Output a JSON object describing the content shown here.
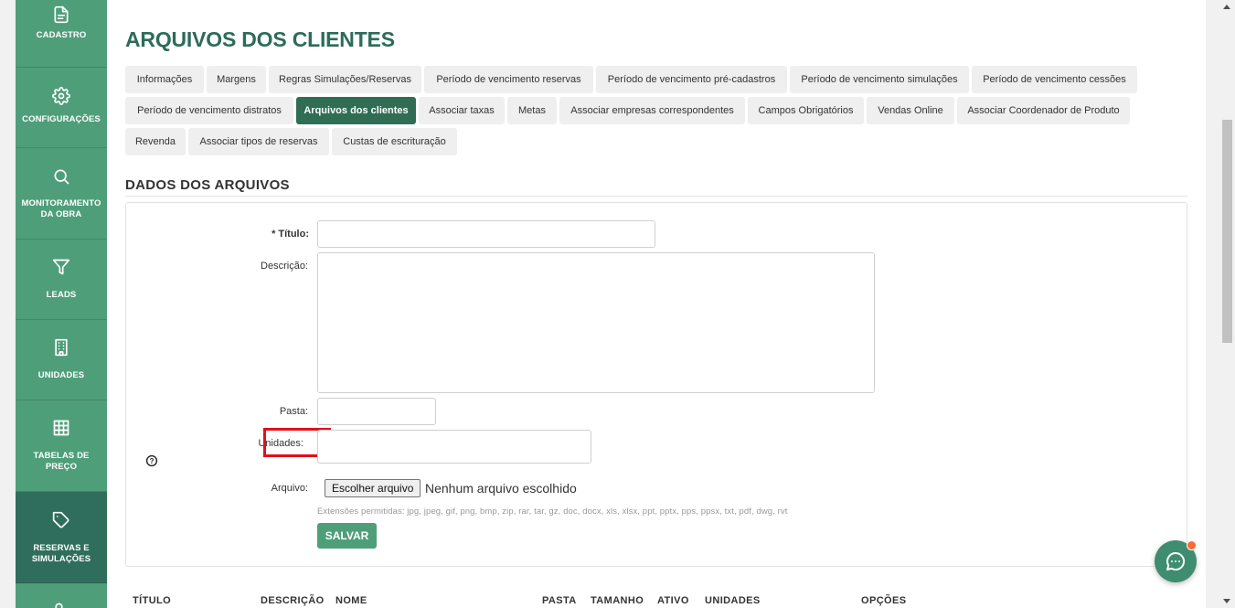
{
  "sidebar": {
    "items": [
      {
        "label": "CADASTRO",
        "icon": "document-icon"
      },
      {
        "label": "CONFIGURAÇÕES",
        "icon": "gear-icon"
      },
      {
        "label": "MONITORAMENTO DA OBRA",
        "icon": "search-icon"
      },
      {
        "label": "LEADS",
        "icon": "funnel-icon"
      },
      {
        "label": "UNIDADES",
        "icon": "building-icon"
      },
      {
        "label": "TABELAS DE PREÇO",
        "icon": "grid-icon"
      },
      {
        "label": "RESERVAS E SIMULAÇÕES",
        "icon": "tag-icon",
        "active": true
      },
      {
        "label": "",
        "icon": "users-icon"
      }
    ]
  },
  "page": {
    "title": "ARQUIVOS DOS CLIENTES"
  },
  "tabs": [
    {
      "label": "Informações"
    },
    {
      "label": "Margens"
    },
    {
      "label": "Regras Simulações/Reservas"
    },
    {
      "label": "Período de vencimento reservas"
    },
    {
      "label": "Período de vencimento pré-cadastros"
    },
    {
      "label": "Período de vencimento simulações"
    },
    {
      "label": "Período de vencimento cessões"
    },
    {
      "label": "Período de vencimento distratos"
    },
    {
      "label": "Arquivos dos clientes",
      "active": true
    },
    {
      "label": "Associar taxas"
    },
    {
      "label": "Metas"
    },
    {
      "label": "Associar empresas correspondentes"
    },
    {
      "label": "Campos Obrigatórios"
    },
    {
      "label": "Vendas Online"
    },
    {
      "label": "Associar Coordenador de Produto"
    },
    {
      "label": "Revenda"
    },
    {
      "label": "Associar tipos de reservas"
    },
    {
      "label": "Custas de escrituração"
    }
  ],
  "section": {
    "title": "DADOS DOS ARQUIVOS"
  },
  "form": {
    "titulo_label": "* Título:",
    "titulo_value": "",
    "descricao_label": "Descrição:",
    "descricao_value": "",
    "pasta_label": "Pasta:",
    "pasta_value": "",
    "unidades_label": "Unidades:",
    "unidades_value": "",
    "arquivo_label": "Arquivo:",
    "file_button": "Escolher arquivo",
    "file_status": "Nenhum arquivo escolhido",
    "file_hint": "Extensões permitidas: jpg, jpeg, gif, png, bmp, zip, rar, tar, gz, doc, docx, xls, xlsx, ppt, pptx, pps, ppsx, txt, pdf, dwg, rvt",
    "save_button": "SALVAR"
  },
  "table": {
    "headers": [
      "TÍTULO",
      "DESCRIÇÃO",
      "NOME",
      "PASTA",
      "TAMANHO",
      "ATIVO",
      "UNIDADES",
      "OPÇÕES"
    ]
  },
  "colors": {
    "sidebar": "#4f9e7a",
    "sidebar_active": "#2f6e5c",
    "title": "#2d6b5b",
    "tab_active": "#2f6e55",
    "highlight": "#e3101b",
    "chat_badge": "#ff6a33"
  }
}
